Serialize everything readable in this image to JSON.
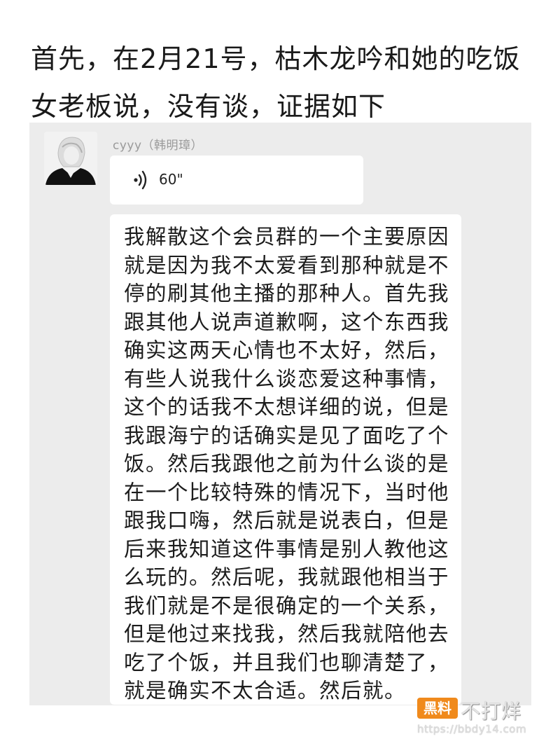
{
  "headline": "首先，在2月21号，枯木龙吟和她的吃饭女老板说，没有谈，证据如下",
  "chat": {
    "sender_name": "cyyy（韩明璋）",
    "voice_message": {
      "icon": "voice-wave-icon",
      "duration": "60\""
    },
    "text_message": "我解散这个会员群的一个主要原因就是因为我不太爱看到那种就是不停的刷其他主播的那种人。首先我跟其他人说声道歉啊，这个东西我确实这两天心情也不太好，然后，有些人说我什么谈恋爱这种事情，这个的话我不太想详细的说，但是我跟海宁的话确实是见了面吃了个饭。然后我跟他之前为什么谈的是在一个比较特殊的情况下，当时他跟我口嗨，然后就是说表白，但是后来我知道这件事情是别人教他这么玩的。然后呢，我就跟他相当于我们就是不是很确定的一个关系，但是他过来找我，然后我就陪他去吃了个饭，并且我们也聊清楚了，就是确实不太合适。然后就。"
  },
  "watermark": {
    "badge": "黑料",
    "slogan": "不打烊",
    "url": "https://bbdy14.com",
    "badge_color": "#f08a1c"
  },
  "colors": {
    "chat_background": "#ececec",
    "bubble_background": "#ffffff",
    "text": "#1c1c1c",
    "sender_name": "#9a9a9a"
  }
}
